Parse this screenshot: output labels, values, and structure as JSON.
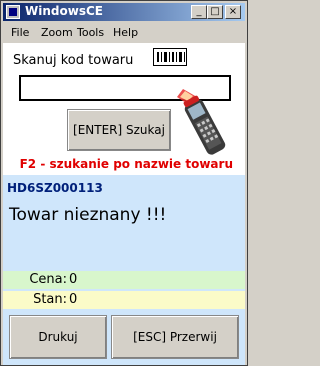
{
  "window": {
    "title": "WindowsCE"
  },
  "titlebar": {
    "min": "_",
    "max": "□",
    "close": "×"
  },
  "menu": [
    "File",
    "Zoom",
    "Tools",
    "Help"
  ],
  "scan": {
    "label": "Skanuj kod towaru",
    "input_value": ""
  },
  "buttons": {
    "search": "[ENTER] Szukaj",
    "print": "Drukuj",
    "cancel": "[ESC] Przerwij"
  },
  "hint": "F2 - szukanie po nazwie towaru",
  "result": {
    "code": "HD6SZ000113",
    "message": "Towar nieznany !!!",
    "cena_label": "Cena:",
    "cena_value": "0",
    "stan_label": "Stan:",
    "stan_value": "0"
  },
  "colors": {
    "title_start": "#0a246a",
    "info_bg": "#cfe6fb",
    "hint_red": "#e00000",
    "code_blue": "#00207a",
    "cena_bg": "#d8f6cc",
    "stan_bg": "#fbfbc8"
  },
  "icons": {
    "barcode": "barcode-icon",
    "scanner": "scanner-icon"
  }
}
